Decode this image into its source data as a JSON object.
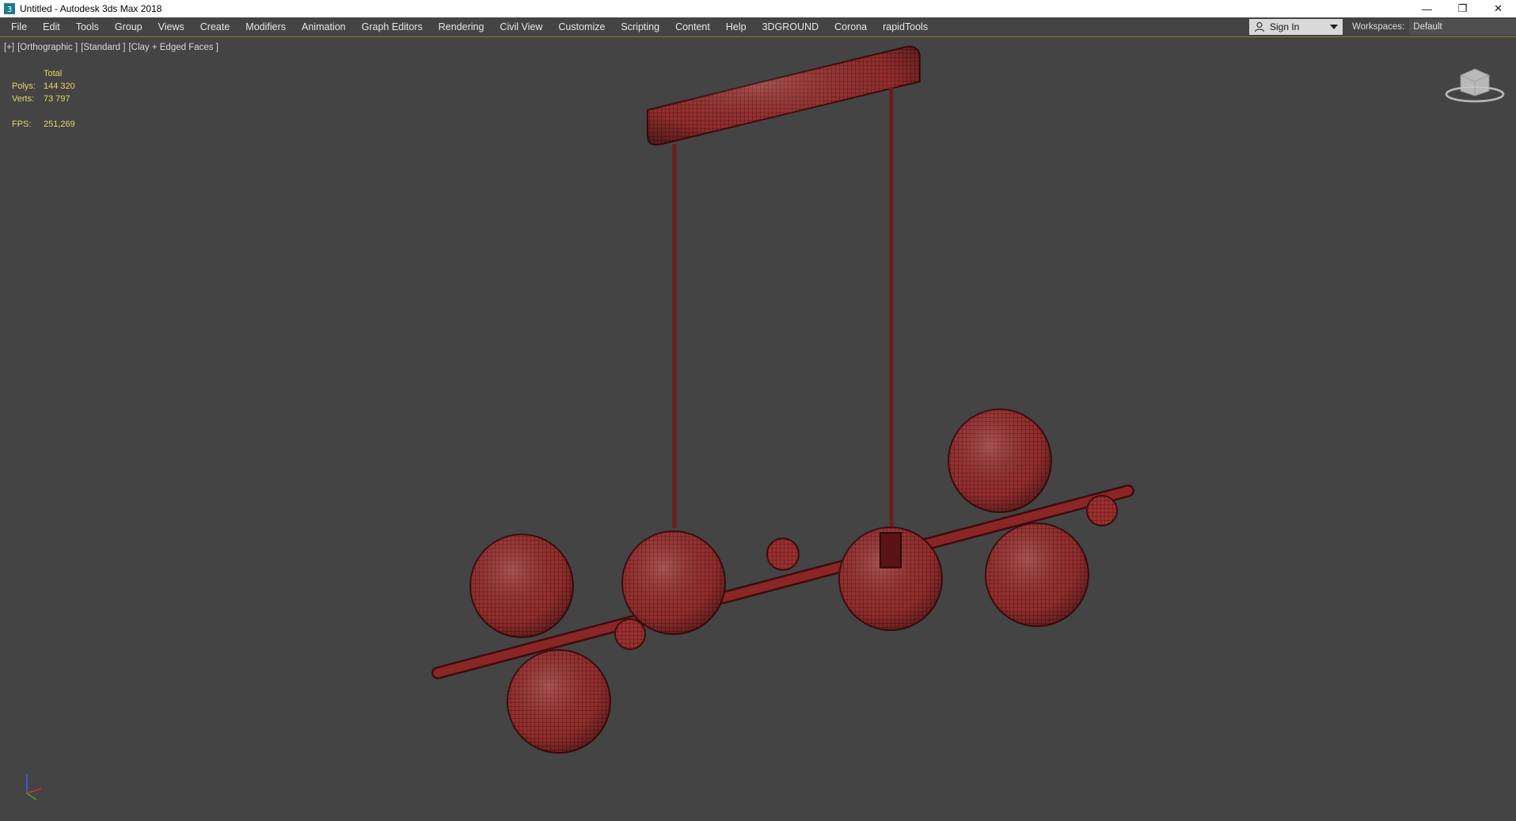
{
  "window": {
    "title": "Untitled - Autodesk 3ds Max 2018",
    "controls": [
      "minimize-icon",
      "restore-icon",
      "close-icon"
    ]
  },
  "menubar": {
    "items": [
      "File",
      "Edit",
      "Tools",
      "Group",
      "Views",
      "Create",
      "Modifiers",
      "Animation",
      "Graph Editors",
      "Rendering",
      "Civil View",
      "Customize",
      "Scripting",
      "Content",
      "Help",
      "3DGROUND",
      "Corona",
      "rapidTools"
    ],
    "sign_in": "Sign In",
    "workspaces_label": "Workspaces:",
    "workspace_value": "Default"
  },
  "viewport": {
    "label_parts": [
      "[+]",
      "[Orthographic ]",
      "[Standard ]",
      "[Clay + Edged Faces ]"
    ],
    "stats": {
      "header": "Total",
      "polys_label": "Polys:",
      "polys_value": "144 320",
      "verts_label": "Verts:",
      "verts_value": "73 797",
      "fps_label": "FPS:",
      "fps_value": "251,269"
    }
  },
  "colors": {
    "viewport_bg": "#444444",
    "model": "#9a3030",
    "wire": "#4a0f0f",
    "stats_text": "#e8d36a"
  }
}
